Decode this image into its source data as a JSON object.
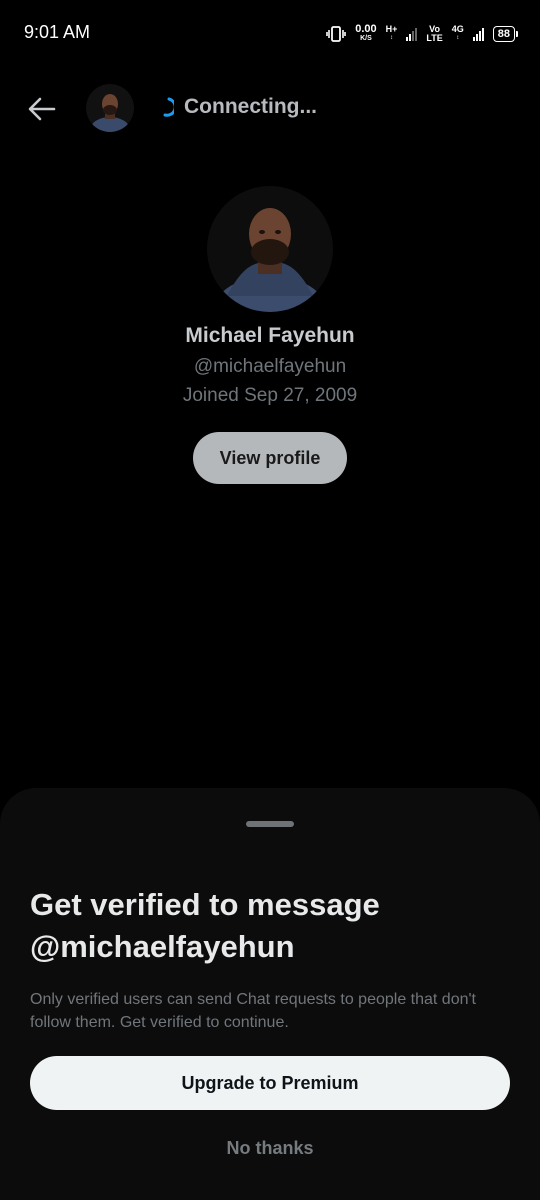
{
  "status_bar": {
    "time": "9:01 AM",
    "net_speed_value": "0.00",
    "net_speed_unit": "K/S",
    "net_type_1": "H+",
    "volte_top": "Vo",
    "volte_bottom": "LTE",
    "net_type_2": "4G",
    "battery": "88"
  },
  "header": {
    "status_text": "Connecting...",
    "accent_color": "#1d9bf0"
  },
  "profile": {
    "name": "Michael Fayehun",
    "handle": "@michaelfayehun",
    "joined": "Joined Sep 27, 2009",
    "view_profile_label": "View profile"
  },
  "sheet": {
    "title": "Get verified to message @michaelfayehun",
    "description": "Only verified users can send Chat requests to people that don't follow them. Get verified to continue.",
    "upgrade_label": "Upgrade to Premium",
    "no_thanks_label": "No thanks"
  },
  "icons": {
    "back": "arrow-left-icon",
    "spinner": "loading-spinner-icon",
    "vibrate": "vibrate-icon",
    "signal": "signal-strength-icon",
    "battery": "battery-icon"
  }
}
